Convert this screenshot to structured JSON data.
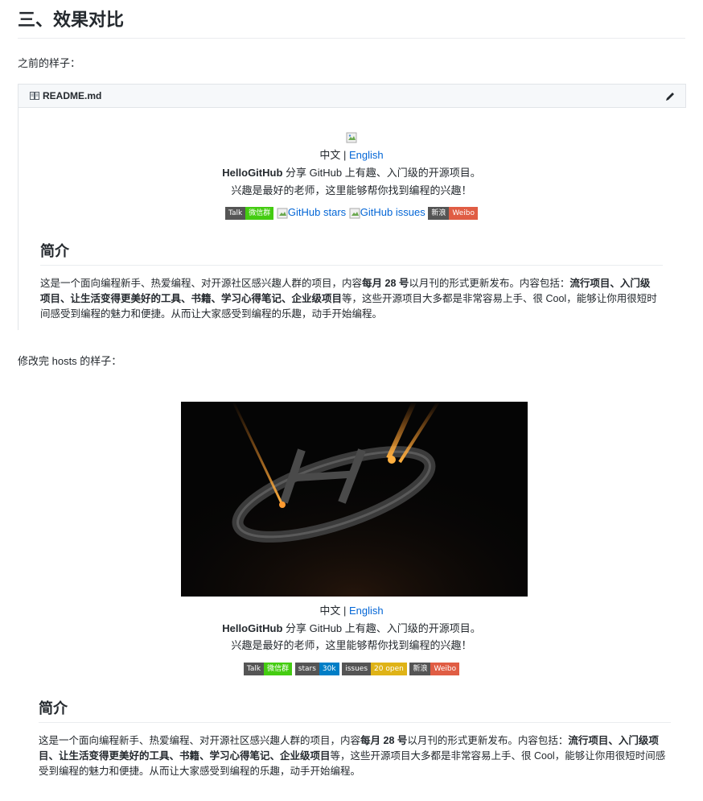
{
  "section_title": "三、效果对比",
  "before_label": "之前的样子：",
  "after_label": "修改完 hosts 的样子：",
  "file_header": {
    "name": "README.md",
    "book_icon": "book-icon",
    "edit_icon": "pencil-icon"
  },
  "readme": {
    "lang_cn": "中文",
    "sep": "|",
    "lang_en": "English",
    "brand": "HelloGitHub",
    "tagline": "分享 GitHub 上有趣、入门级的开源项目。",
    "slogan": "兴趣是最好的老师，这里能够帮你找到编程的兴趣！",
    "before_badges": {
      "talk_left": "Talk",
      "talk_right": "微信群",
      "stars_alt": "GitHub stars",
      "issues_alt": "GitHub issues",
      "weibo_left": "新浪",
      "weibo_right": "Weibo"
    },
    "after_badges": {
      "talk_left": "Talk",
      "talk_right": "微信群",
      "stars_left": "stars",
      "stars_right": "30k",
      "issues_left": "issues",
      "issues_right": "20 open",
      "weibo_left": "新浪",
      "weibo_right": "Weibo"
    },
    "intro_title": "简介",
    "intro": {
      "p1": "这是一个面向编程新手、热爱编程、对开源社区感兴趣人群的项目，内容",
      "b1": "每月 28 号",
      "p2": "以月刊的形式更新发布。内容包括：",
      "b2": "流行项目、入门级项目、让生活变得更美好的工具、书籍、学习心得笔记、企业级项目",
      "p3": "等，这些开源项目大多都是非常容易上手、很 Cool，能够让你用很短时间感受到编程的魅力和便捷。从而让大家感受到编程的乐趣，动手开始编程。"
    }
  },
  "colors": {
    "talk_green": "#4c1",
    "stars_blue": "#007ec6",
    "issues_yellow": "#dfb317",
    "weibo_red": "#e05d44",
    "link": "#0366d6"
  }
}
